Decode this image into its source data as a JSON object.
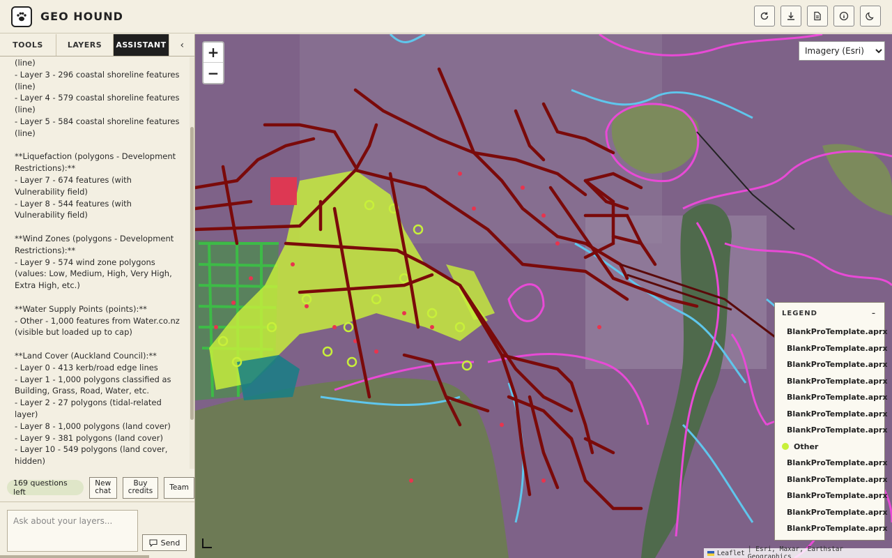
{
  "app": {
    "title": "GEO HOUND"
  },
  "header": {
    "actions": [
      {
        "name": "refresh-icon"
      },
      {
        "name": "download-icon"
      },
      {
        "name": "document-icon"
      },
      {
        "name": "info-icon"
      },
      {
        "name": "dark-mode-icon"
      }
    ]
  },
  "sidebar": {
    "tabs": [
      "TOOLS",
      "LAYERS",
      "ASSISTANT"
    ],
    "active_tab": "ASSISTANT",
    "collapse_glyph": "‹",
    "chat_text": "(line)\n- Layer 3 - 296 coastal shoreline features (line)\n- Layer 4 - 579 coastal shoreline features (line)\n- Layer 5 - 584 coastal shoreline features (line)\n\n**Liquefaction (polygons - Development Restrictions):**\n- Layer 7 - 674 features (with Vulnerability field)\n- Layer 8 - 544 features (with Vulnerability field)\n\n**Wind Zones (polygons - Development Restrictions):**\n- Layer 9 - 574 wind zone polygons (values: Low, Medium, High, Very High, Extra High, etc.)\n\n**Water Supply Points (points):**\n- Other - 1,000 features from Water.co.nz (visible but loaded up to cap)\n\n**Land Cover (Auckland Council):**\n- Layer 0 - 413 kerb/road edge lines\n- Layer 1 - 1,000 polygons classified as Building, Grass, Road, Water, etc.\n- Layer 2 - 27 polygons (tidal-related layer)\n- Layer 8 - 1,000 polygons (land cover)\n- Layer 9 - 381 polygons (land cover)\n- Layer 10 - 549 polygons (land cover, hidden)",
    "questions_left": "169 questions left",
    "new_chat_label": "New chat",
    "buy_credits_label": "Buy credits",
    "team_label": "Team",
    "input_placeholder": "Ask about your layers...",
    "send_label": "Send"
  },
  "map": {
    "zoom_in": "+",
    "zoom_out": "−",
    "basemap_selected": "Imagery (Esri)",
    "legend": {
      "title": "LEGEND",
      "collapse": "–",
      "items": [
        {
          "label": "BlankProTemplate.aprx",
          "color": "#e8344e",
          "kind": "line"
        },
        {
          "label": "BlankProTemplate.aprx",
          "color": "#3dbb47",
          "kind": "line"
        },
        {
          "label": "BlankProTemplate.aprx",
          "color": "#4a6ad1",
          "kind": "line"
        },
        {
          "label": "BlankProTemplate.aprx",
          "color": "#f08a4a",
          "kind": "line"
        },
        {
          "label": "BlankProTemplate.aprx",
          "color": "#8e2fb8",
          "kind": "box"
        },
        {
          "label": "BlankProTemplate.aprx",
          "color": "#5fe3ee",
          "kind": "box"
        },
        {
          "label": "BlankProTemplate.aprx",
          "color": "#e84ad6",
          "kind": "box"
        },
        {
          "label": "Other",
          "color": "#c8f03a",
          "kind": "dot"
        },
        {
          "label": "BlankProTemplate.aprx",
          "color": "#167f86",
          "kind": "box"
        },
        {
          "label": "BlankProTemplate.aprx",
          "color": "#7a0a0a",
          "kind": "line"
        },
        {
          "label": "BlankProTemplate.aprx",
          "color": "#7c7a1a",
          "kind": "box"
        },
        {
          "label": "BlankProTemplate.aprx",
          "color": "#d8204a",
          "kind": "box"
        },
        {
          "label": "BlankProTemplate.aprx",
          "color": "#3aae4a",
          "kind": "box"
        }
      ]
    },
    "attribution_leaflet": "Leaflet",
    "attribution_sources": "| Esri, Maxar, Earthstar Geographics"
  }
}
